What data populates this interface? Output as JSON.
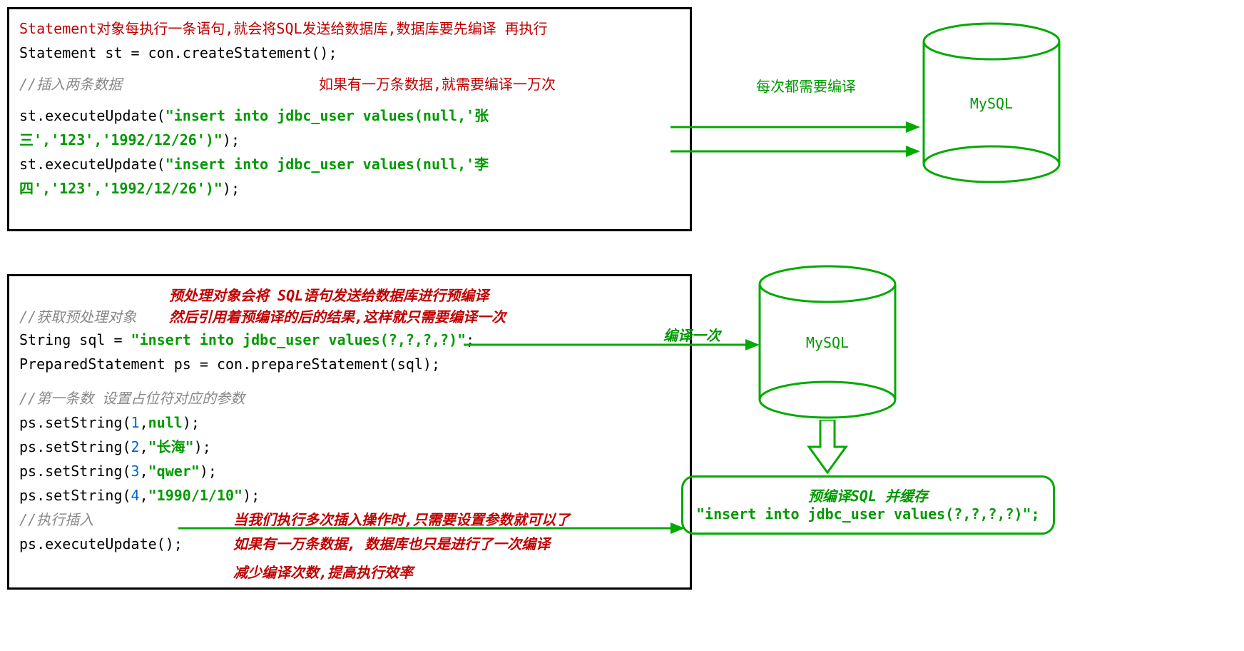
{
  "box1": {
    "title_red": "Statement对象每执行一条语句,就会将SQL发送给数据库,数据库要先编译  再执行",
    "line1": "Statement st = con.createStatement();",
    "comment1": "//插入两条数据",
    "red_overlay1": "如果有一万条数据,就需要编译一万次",
    "exec1_a": "st.executeUpdate(",
    "exec1_b": "\"insert  into jdbc_user values(null,'张三','123','1992/12/26')\"",
    "exec1_c": ");",
    "exec2_a": "st.executeUpdate(",
    "exec2_b": "\"insert  into jdbc_user values(null,'李四','123','1992/12/26')\"",
    "exec2_c": ");"
  },
  "top_green_note": "每次都需要编译",
  "mysql_label": "MySQL",
  "box2": {
    "comment_get": "//获取预处理对象",
    "red_note1": "预处理对象会将 SQL语句发送给数据库进行预编译",
    "red_note2": "然后引用着预编译的后的结果,这样就只需要编译一次",
    "sql_decl_a": "String sql = ",
    "sql_decl_b": "\"insert  into jdbc_user values(?,?,?,?)\"",
    "sql_decl_c": ";",
    "ps_line": "PreparedStatement ps = con.prepareStatement(sql);",
    "compile_once": "编译一次",
    "comment_params": "//第一条数 设置占位符对应的参数",
    "set1_a": "ps.setString(",
    "set1_n": "1",
    "set1_b": ",",
    "set1_v": "null",
    "set1_c": ");",
    "set2_a": "ps.setString(",
    "set2_n": "2",
    "set2_b": ",",
    "set2_v": "\"长海\"",
    "set2_c": ");",
    "set3_a": "ps.setString(",
    "set3_n": "3",
    "set3_b": ",",
    "set3_v": "\"qwer\"",
    "set3_c": ");",
    "set4_a": "ps.setString(",
    "set4_n": "4",
    "set4_b": ",",
    "set4_v": "\"1990/1/10\"",
    "set4_c": ");",
    "comment_exec": "//执行插入",
    "exec_line": "ps.executeUpdate();",
    "red_note3": "当我们执行多次插入操作时,只需要设置参数就可以了",
    "red_note4": "如果有一万条数据, 数据库也只是进行了一次编译",
    "red_note5": "减少编译次数,提高执行效率"
  },
  "cache": {
    "title": "预编译SQL 并缓存",
    "sql": "\"insert  into jdbc_user values(?,?,?,?)\";"
  }
}
